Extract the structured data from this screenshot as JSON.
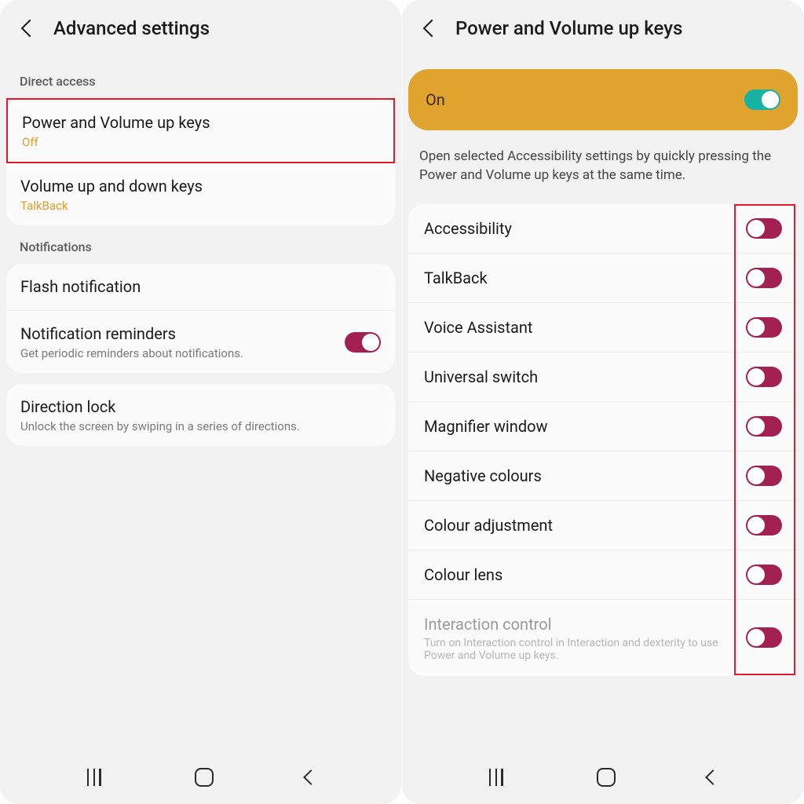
{
  "left": {
    "header": {
      "title": "Advanced settings"
    },
    "sections": {
      "direct_access": {
        "header": "Direct access",
        "items": [
          {
            "title": "Power and Volume up keys",
            "sub": "Off"
          },
          {
            "title": "Volume up and down keys",
            "sub": "TalkBack"
          }
        ]
      },
      "notifications": {
        "header": "Notifications",
        "items": [
          {
            "title": "Flash notification"
          },
          {
            "title": "Notification reminders",
            "desc": "Get periodic reminders about notifications.",
            "toggle": true
          }
        ]
      },
      "direction": {
        "title": "Direction lock",
        "desc": "Unlock the screen by swiping in a series of directions."
      }
    }
  },
  "right": {
    "header": {
      "title": "Power and Volume up keys"
    },
    "banner": {
      "label": "On",
      "toggle": true
    },
    "description": "Open selected Accessibility settings by quickly pressing the Power and Volume up keys at the same time.",
    "items": [
      {
        "title": "Accessibility",
        "toggle": true
      },
      {
        "title": "TalkBack",
        "toggle": true
      },
      {
        "title": "Voice Assistant",
        "toggle": true
      },
      {
        "title": "Universal switch",
        "toggle": true
      },
      {
        "title": "Magnifier window",
        "toggle": true
      },
      {
        "title": "Negative colours",
        "toggle": true
      },
      {
        "title": "Colour adjustment",
        "toggle": true
      },
      {
        "title": "Colour lens",
        "toggle": true
      },
      {
        "title": "Interaction control",
        "desc": "Turn on Interaction control in Interaction and dexterity to use Power and Volume up keys.",
        "toggle": true,
        "disabled": true
      }
    ]
  }
}
